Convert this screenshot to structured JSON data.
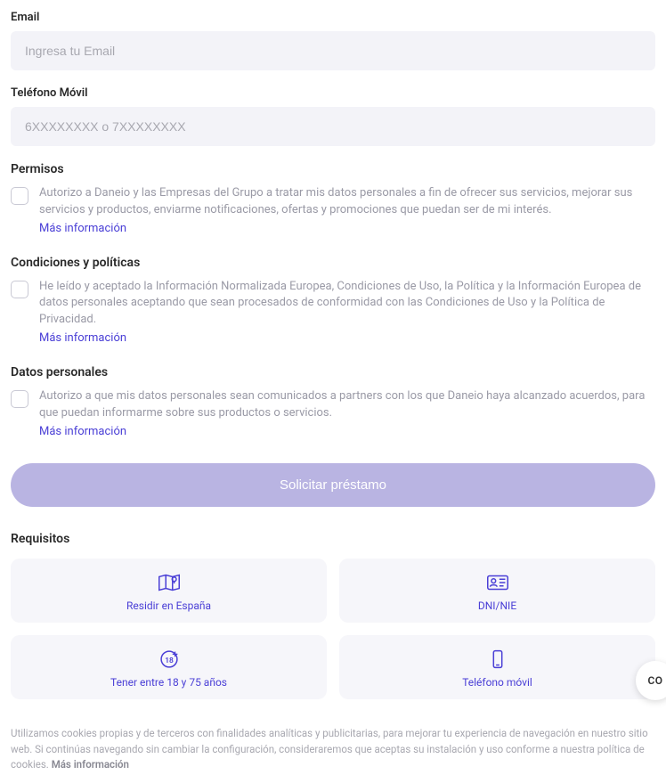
{
  "email": {
    "label": "Email",
    "placeholder": "Ingresa tu Email"
  },
  "phone": {
    "label": "Teléfono Móvil",
    "placeholder": "6XXXXXXXX o 7XXXXXXXX"
  },
  "permissions": {
    "title": "Permisos",
    "text": "Autorizo a Daneio y las Empresas del Grupo a tratar mis datos personales a fin de ofrecer sus servicios, mejorar sus servicios y productos, enviarme notificaciones, ofertas y promociones que puedan ser de mi interés.",
    "more": "Más información"
  },
  "conditions": {
    "title": "Condiciones y políticas",
    "text": "He leído y aceptado la Información Normalizada Europea, Condiciones de Uso, la Política y la Información Europea de datos personales aceptando que sean procesados de conformidad con las Condiciones de Uso y la Política de Privacidad.",
    "more": "Más información"
  },
  "personal": {
    "title": "Datos personales",
    "text": "Autorizo a que mis datos personales sean comunicados a partners con los que Daneio haya alcanzado acuerdos, para que puedan informarme sobre sus productos o servicios.",
    "more": "Más información"
  },
  "submit_label": "Solicitar préstamo",
  "requirements": {
    "title": "Requisitos",
    "items": [
      {
        "label": "Residir en España"
      },
      {
        "label": "DNI/NIE"
      },
      {
        "label": "Tener entre 18 y 75 años"
      },
      {
        "label": "Teléfono móvil"
      }
    ]
  },
  "cookies": {
    "text": "Utilizamos cookies propias y de terceros con finalidades analíticas y publicitarias, para mejorar tu experiencia de navegación en nuestro sitio web. Si continúas navegando sin cambiar la configuración, consideraremos que aceptas su instalación y uso conforme a nuestra política de cookies. ",
    "more": "Más información"
  },
  "fab_label": "CO"
}
